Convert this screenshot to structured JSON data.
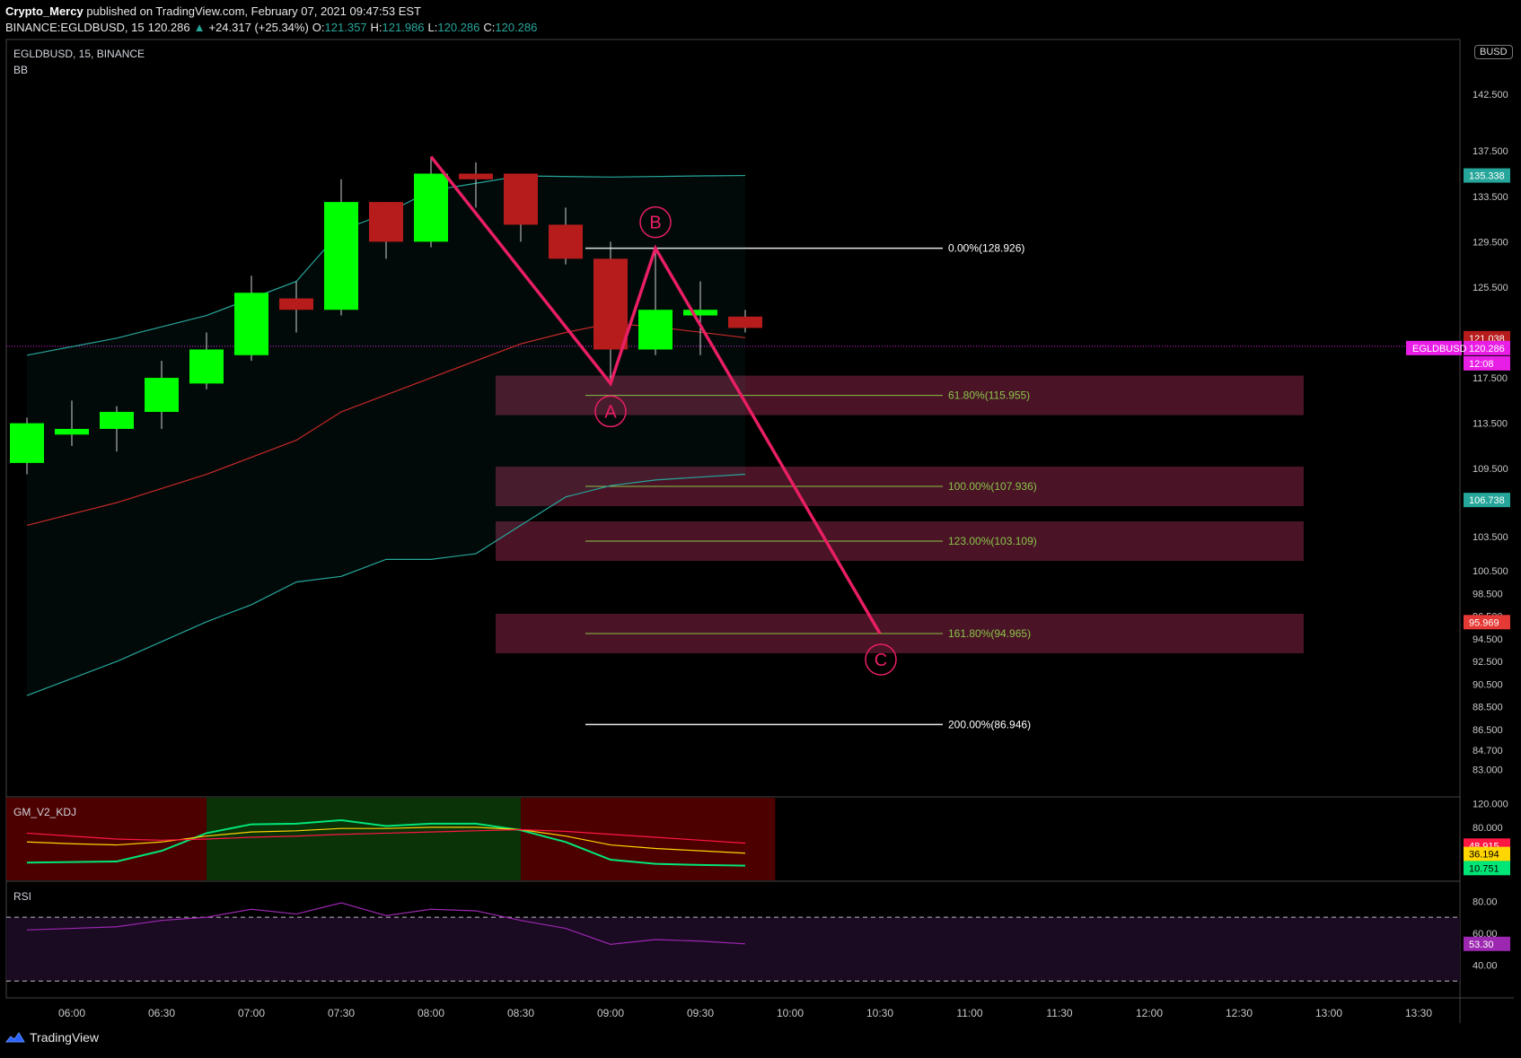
{
  "header": {
    "author": "Crypto_Mercy",
    "published": "published on TradingView.com, February 07, 2021 09:47:53 EST",
    "symbol_line": "BINANCE:EGLDBUSD, 15",
    "last": "120.286",
    "change": "+24.317 (+25.34%)",
    "o_label": "O:",
    "o": "121.357",
    "h_label": "H:",
    "h": "121.986",
    "l_label": "L:",
    "l": "120.286",
    "c_label": "C:",
    "c": "120.286"
  },
  "pane_labels": {
    "symbol": "EGLDBUSD, 15, BINANCE",
    "indicator": "BB",
    "kdj": "GM_V2_KDJ",
    "rsi": "RSI"
  },
  "currency_badge": "BUSD",
  "footer": {
    "brand": "TradingView"
  },
  "colors": {
    "bull": "#00ff00",
    "bear": "#b71c1c",
    "bb_band": "#26a69a",
    "bb_basis": "#c62828",
    "pattern": "#e91e63",
    "fib_zone": "#4a1426",
    "fib_line": "#8bc34a",
    "rsi": "#9c27b0"
  },
  "chart_data": [
    {
      "type": "candlestick",
      "title": "EGLDBUSD, 15, BINANCE",
      "x_ticks": [
        "06:00",
        "06:30",
        "07:00",
        "07:30",
        "08:00",
        "08:30",
        "09:00",
        "09:30",
        "10:00",
        "10:30",
        "11:00",
        "11:30",
        "12:00",
        "12:30",
        "13:00",
        "13:30"
      ],
      "y_ticks": [
        "142.500",
        "137.500",
        "133.500",
        "129.500",
        "125.500",
        "117.500",
        "113.500",
        "109.500",
        "103.500",
        "100.500",
        "98.500",
        "96.500",
        "94.500",
        "92.500",
        "90.500",
        "88.500",
        "86.500",
        "84.700",
        "83.000"
      ],
      "y_range": [
        82,
        149
      ],
      "candles": [
        {
          "t": "05:45",
          "o": 110.0,
          "h": 114.0,
          "l": 109.0,
          "c": 113.5
        },
        {
          "t": "06:00",
          "o": 112.5,
          "h": 115.5,
          "l": 111.5,
          "c": 113.0
        },
        {
          "t": "06:15",
          "o": 113.0,
          "h": 115.0,
          "l": 111.0,
          "c": 114.5
        },
        {
          "t": "06:30",
          "o": 114.5,
          "h": 119.0,
          "l": 113.0,
          "c": 117.5
        },
        {
          "t": "06:45",
          "o": 117.0,
          "h": 121.5,
          "l": 116.5,
          "c": 120.0
        },
        {
          "t": "07:00",
          "o": 119.5,
          "h": 126.5,
          "l": 119.0,
          "c": 125.0
        },
        {
          "t": "07:15",
          "o": 124.5,
          "h": 126.0,
          "l": 121.5,
          "c": 123.5
        },
        {
          "t": "07:30",
          "o": 123.5,
          "h": 135.0,
          "l": 123.0,
          "c": 133.0
        },
        {
          "t": "07:45",
          "o": 133.0,
          "h": 133.0,
          "l": 128.0,
          "c": 129.5
        },
        {
          "t": "08:00",
          "o": 129.5,
          "h": 137.0,
          "l": 129.0,
          "c": 135.5
        },
        {
          "t": "08:15",
          "o": 135.5,
          "h": 136.5,
          "l": 132.5,
          "c": 135.0
        },
        {
          "t": "08:30",
          "o": 135.5,
          "h": 135.5,
          "l": 129.5,
          "c": 131.0
        },
        {
          "t": "08:45",
          "o": 131.0,
          "h": 132.5,
          "l": 127.5,
          "c": 128.0
        },
        {
          "t": "09:00",
          "o": 128.0,
          "h": 129.5,
          "l": 117.0,
          "c": 120.0
        },
        {
          "t": "09:15",
          "o": 120.0,
          "h": 128.9,
          "l": 119.5,
          "c": 123.5
        },
        {
          "t": "09:30",
          "o": 123.0,
          "h": 126.0,
          "l": 119.5,
          "c": 123.5
        },
        {
          "t": "09:45",
          "o": 122.9,
          "h": 123.5,
          "l": 121.5,
          "c": 121.9
        }
      ],
      "bollinger": {
        "upper": [
          [
            "05:45",
            119.5
          ],
          [
            "06:15",
            121.0
          ],
          [
            "06:45",
            123.0
          ],
          [
            "07:15",
            126.0
          ],
          [
            "07:30",
            130.5
          ],
          [
            "07:45",
            132.0
          ],
          [
            "08:00",
            134.0
          ],
          [
            "08:30",
            135.3
          ],
          [
            "09:00",
            135.2
          ],
          [
            "09:30",
            135.3
          ],
          [
            "09:45",
            135.338
          ]
        ],
        "basis": [
          [
            "05:45",
            104.5
          ],
          [
            "06:15",
            106.5
          ],
          [
            "06:45",
            109.0
          ],
          [
            "07:15",
            112.0
          ],
          [
            "07:30",
            114.5
          ],
          [
            "08:00",
            117.5
          ],
          [
            "08:30",
            120.5
          ],
          [
            "08:45",
            121.5
          ],
          [
            "09:00",
            122.3
          ],
          [
            "09:15",
            122.0
          ],
          [
            "09:45",
            121.038
          ]
        ],
        "lower": [
          [
            "05:45",
            89.5
          ],
          [
            "06:15",
            92.5
          ],
          [
            "06:45",
            96.0
          ],
          [
            "07:00",
            97.5
          ],
          [
            "07:15",
            99.5
          ],
          [
            "07:30",
            100.0
          ],
          [
            "07:45",
            101.5
          ],
          [
            "08:00",
            101.5
          ],
          [
            "08:15",
            102.0
          ],
          [
            "08:30",
            104.5
          ],
          [
            "08:45",
            107.0
          ],
          [
            "09:00",
            108.0
          ],
          [
            "09:15",
            108.5
          ],
          [
            "09:45",
            109.0
          ]
        ]
      },
      "pattern": {
        "label_a": "A",
        "label_b": "B",
        "label_c": "C",
        "points": [
          [
            "08:00",
            137.0
          ],
          [
            "09:00",
            117.0
          ],
          [
            "09:15",
            128.926
          ],
          [
            "10:30",
            94.965
          ]
        ]
      },
      "fib_levels": [
        {
          "label": "0.00%(128.926)",
          "price": 128.926,
          "zone": false
        },
        {
          "label": "61.80%(115.955)",
          "price": 115.955,
          "zone": true
        },
        {
          "label": "100.00%(107.936)",
          "price": 107.936,
          "zone": true
        },
        {
          "label": "123.00%(103.109)",
          "price": 103.109,
          "zone": true
        },
        {
          "label": "161.80%(94.965)",
          "price": 94.965,
          "zone": true
        },
        {
          "label": "200.00%(86.946)",
          "price": 86.946,
          "zone": false
        }
      ],
      "price_tags": [
        {
          "text": "135.338",
          "bg": "#26a69a"
        },
        {
          "text": "121.038",
          "bg": "#b71c1c"
        },
        {
          "text": "120.286",
          "bg": "#e91ee6",
          "name": "EGLDBUSD",
          "countdown": "12:08"
        },
        {
          "text": "106.738",
          "bg": "#26a69a"
        },
        {
          "text": "95.969",
          "bg": "#e53935"
        }
      ]
    },
    {
      "type": "line",
      "title": "GM_V2_KDJ",
      "y_ticks": [
        "120.000",
        "80.000"
      ],
      "y_range": [
        -10,
        130
      ],
      "x": [
        "05:45",
        "06:00",
        "06:15",
        "06:30",
        "06:45",
        "07:00",
        "07:15",
        "07:30",
        "07:45",
        "08:00",
        "08:15",
        "08:30",
        "08:45",
        "09:00",
        "09:15",
        "09:30",
        "09:45"
      ],
      "series": [
        {
          "color": "#00e676",
          "values": [
            20,
            21,
            22,
            40,
            70,
            85,
            86,
            92,
            82,
            86,
            86,
            75,
            55,
            25,
            18,
            16,
            15
          ]
        },
        {
          "color": "#ffd600",
          "values": [
            55,
            52,
            50,
            55,
            65,
            72,
            74,
            78,
            78,
            80,
            80,
            76,
            65,
            50,
            44,
            40,
            36
          ]
        },
        {
          "color": "#ff1744",
          "values": [
            70,
            65,
            60,
            58,
            60,
            63,
            65,
            68,
            70,
            72,
            74,
            76,
            73,
            68,
            63,
            58,
            53
          ]
        }
      ],
      "regions": [
        {
          "from": "05:30",
          "to": "06:45",
          "tone": "red"
        },
        {
          "from": "06:45",
          "to": "08:30",
          "tone": "green"
        },
        {
          "from": "08:30",
          "to": "09:55",
          "tone": "red"
        }
      ],
      "value_tags": [
        {
          "text": "48.915",
          "bg": "#ff1744"
        },
        {
          "text": "36.194",
          "bg": "#ffd600"
        },
        {
          "text": "10.751",
          "bg": "#00e676"
        }
      ]
    },
    {
      "type": "line",
      "title": "RSI",
      "y_ticks": [
        "80.00",
        "60.00",
        "40.00"
      ],
      "y_range": [
        20,
        92
      ],
      "bands": [
        70,
        30
      ],
      "x": [
        "05:45",
        "06:00",
        "06:15",
        "06:30",
        "06:45",
        "07:00",
        "07:15",
        "07:30",
        "07:45",
        "08:00",
        "08:15",
        "08:30",
        "08:45",
        "09:00",
        "09:15",
        "09:30",
        "09:45"
      ],
      "series": [
        {
          "color": "#9c27b0",
          "values": [
            62,
            63,
            64,
            68,
            70,
            75,
            72,
            79,
            71,
            75,
            74,
            68,
            63,
            53,
            56,
            55,
            53.3
          ]
        }
      ],
      "value_tags": [
        {
          "text": "53.30",
          "bg": "#9c27b0"
        }
      ]
    }
  ]
}
